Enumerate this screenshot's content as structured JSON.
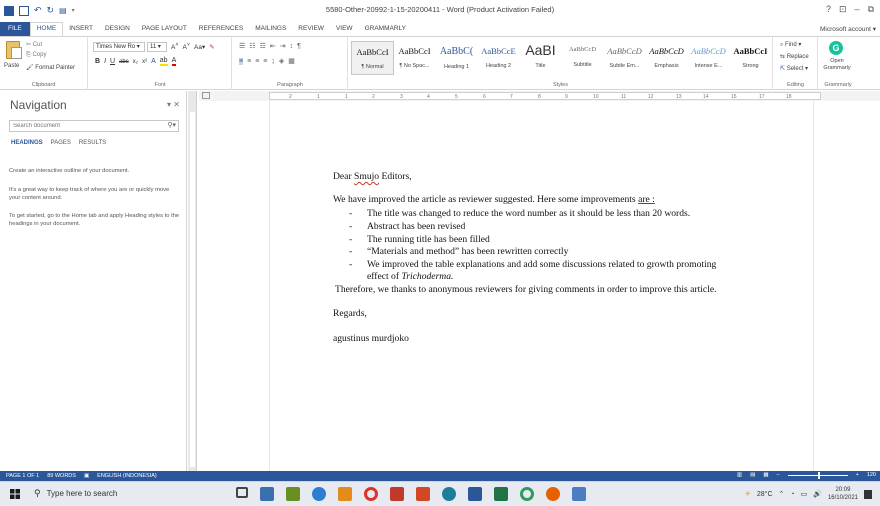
{
  "window": {
    "title": "5580-Other-20992-1-15-20200411 - Word (Product Activation Failed)",
    "controls": [
      "?",
      "⊡",
      "–",
      "⧉"
    ]
  },
  "ribbon_tabs": [
    "FILE",
    "HOME",
    "INSERT",
    "DESIGN",
    "PAGE LAYOUT",
    "REFERENCES",
    "MAILINGS",
    "REVIEW",
    "VIEW",
    "GRAMMARLY"
  ],
  "active_tab": "HOME",
  "account": "Microsoft account ▾",
  "clipboard": {
    "paste": "Paste",
    "cut": "✂ Cut",
    "copy": "⎘ Copy",
    "format_painter": "🖌 Format Painter",
    "label": "Clipboard"
  },
  "font": {
    "name": "Times New Ro ▾",
    "size": "11 ▾",
    "label": "Font"
  },
  "paragraph": {
    "label": "Paragraph"
  },
  "styles": {
    "label": "Styles",
    "items": [
      {
        "sample": "AaBbCcI",
        "name": "¶ Normal"
      },
      {
        "sample": "AaBbCcI",
        "name": "¶ No Spac..."
      },
      {
        "sample": "AaBbC(",
        "name": "Heading 1"
      },
      {
        "sample": "AaBbCcE",
        "name": "Heading 2"
      },
      {
        "sample": "AaBI",
        "name": "Title"
      },
      {
        "sample": "AaBbCcD",
        "name": "Subtitle"
      },
      {
        "sample": "AaBbCcD",
        "name": "Subtle Em..."
      },
      {
        "sample": "AaBbCcD",
        "name": "Emphasis"
      },
      {
        "sample": "AaBbCcD",
        "name": "Intense E..."
      },
      {
        "sample": "AaBbCcI",
        "name": "Strong"
      }
    ]
  },
  "editing": {
    "find": "Find ▾",
    "replace": "Replace",
    "select": "Select ▾",
    "label": "Editing"
  },
  "grammarly": {
    "open": "Open Grammarly",
    "label": "Grammarly"
  },
  "navigation": {
    "title": "Navigation",
    "search_placeholder": "Search document",
    "tabs": [
      "HEADINGS",
      "PAGES",
      "RESULTS"
    ],
    "help": [
      "Create an interactive outline of your document.",
      "It's a great way to keep track of where you are or quickly move your content around.",
      "To get started, go to the Home tab and apply Heading styles to the headings in your document."
    ]
  },
  "ruler": {
    "ticks": [
      "2",
      "1",
      "1",
      "2",
      "3",
      "4",
      "5",
      "6",
      "7",
      "8",
      "9",
      "10",
      "11",
      "12",
      "13",
      "14",
      "15",
      "17",
      "18"
    ]
  },
  "document": {
    "greeting_pre": "Dear ",
    "greeting_word": "Smujo",
    "greeting_post": " Editors,",
    "intro_pre": "We have improved the article as reviewer suggested.  Here some improvements ",
    "intro_link": "are :",
    "bullets": [
      "The title was changed to reduce the word number as it should be less than 20 words.",
      "Abstract has been revised",
      "The running title has been filled",
      "“Materials and method” has been rewritten correctly",
      "We improved the table explanations and add some discussions related to growth promoting"
    ],
    "bullet_continuation_pre": "effect of ",
    "bullet_continuation_italic": "Trichoderma.",
    "closing_line": "Therefore, we thanks to anonymous reviewers for giving comments in order to improve this article.",
    "regards": "Regards,",
    "signature": "agustinus murdjoko"
  },
  "status_bar": {
    "page": "PAGE 1 OF 1",
    "words": "89 WORDS",
    "language": "ENGLISH (INDONESIA)",
    "zoom": "120"
  },
  "taskbar": {
    "search_placeholder": "Type here to search",
    "temperature": "28°C",
    "time": "20:09",
    "date": "16/10/2021"
  },
  "colors": {
    "word_blue": "#2b579a",
    "grammarly_green": "#15c39a"
  }
}
